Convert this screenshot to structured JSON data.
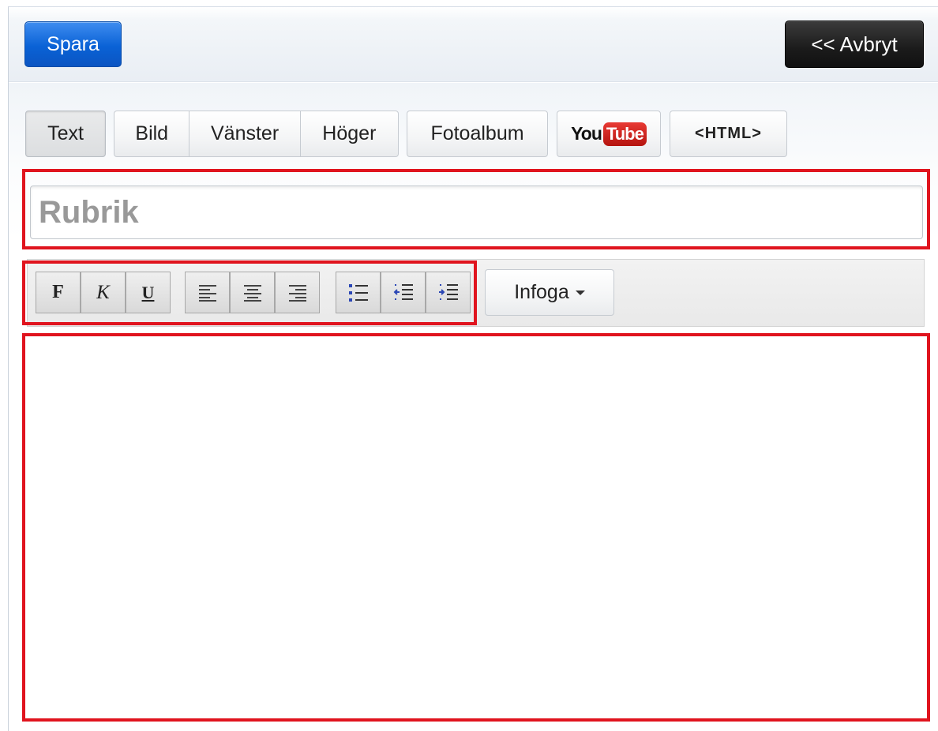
{
  "header": {
    "save_label": "Spara",
    "cancel_label": "<< Avbryt"
  },
  "type_toolbar": {
    "text": "Text",
    "image": "Bild",
    "left": "Vänster",
    "right": "Höger",
    "photo_album": "Fotoalbum",
    "youtube_you": "You",
    "youtube_tube": "Tube",
    "html": "<HTML>"
  },
  "title_field": {
    "placeholder": "Rubrik",
    "value": ""
  },
  "format_toolbar": {
    "bold": "F",
    "italic": "K",
    "underline": "U",
    "insert_label": "Infoga"
  },
  "colors": {
    "primary_button": "#0a62d6",
    "cancel_button": "#1b1b1b",
    "highlight": "#e0141e",
    "youtube_red": "#c9201a"
  }
}
